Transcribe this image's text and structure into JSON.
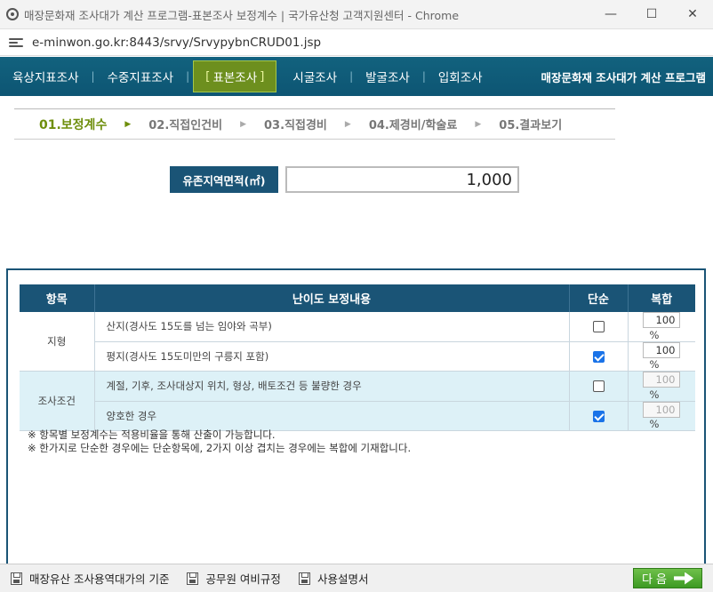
{
  "window": {
    "title": "매장문화재 조사대가 계산 프로그램-표본조사 보정계수 | 국가유산청 고객지원센터 - Chrome",
    "url": "e-minwon.go.kr:8443/srvy/SrvypybnCRUD01.jsp"
  },
  "nav": {
    "items": [
      "육상지표조사",
      "수중지표조사",
      "표본조사",
      "시굴조사",
      "발굴조사",
      "입회조사"
    ],
    "active_index": 2,
    "brand": "매장문화재 조사대가 계산 프로그램"
  },
  "steps": {
    "items": [
      "01.보정계수",
      "02.직접인건비",
      "03.직접경비",
      "04.제경비/학술료",
      "05.결과보기"
    ],
    "current_index": 0
  },
  "area": {
    "label": "유존지역면적(㎡)",
    "value": "1,000"
  },
  "table": {
    "headers": {
      "item": "항목",
      "content": "난이도 보정내용",
      "simple": "단순",
      "compound": "복합"
    },
    "rows": [
      {
        "group": "지형",
        "desc": "산지(경사도 15도를 넘는 임야와 곡부)",
        "simple_checked": false,
        "compound_value": "100",
        "unit": "%"
      },
      {
        "group": "",
        "desc": "평지(경사도 15도미만의 구릉지 포함)",
        "simple_checked": true,
        "compound_value": "100",
        "unit": "%"
      },
      {
        "group": "조사조건",
        "desc": "계절, 기후, 조사대상지 위치, 형상, 배토조건 등 불량한 경우",
        "simple_checked": false,
        "compound_value": "100",
        "unit": "%"
      },
      {
        "group": "",
        "desc": "양호한 경우",
        "simple_checked": true,
        "compound_value": "100",
        "unit": "%"
      }
    ]
  },
  "notes": [
    "※ 항목별 보정계수는 적용비율을 통해 산출이 가능합니다.",
    "※ 한가지로 단순한 경우에는 단순항목에, 2가지 이상 겹치는 경우에는 복합에 기재합니다."
  ],
  "footer": {
    "links": [
      "매장유산 조사용역대가의 기준",
      "공무원 여비규정",
      "사용설명서"
    ],
    "next_label": "다 음"
  },
  "colors": {
    "nav_bg": "#12627e",
    "active_bg": "#6d8f1e",
    "header_bg": "#1a5476",
    "current_step": "#6e8e0b",
    "row_highlight": "#ddf1f7"
  }
}
